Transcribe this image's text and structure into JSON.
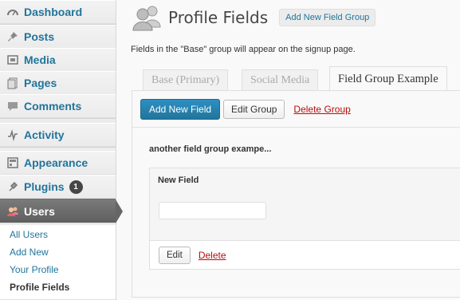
{
  "sidebar": {
    "items": [
      {
        "label": "Dashboard",
        "icon": "dashboard-icon"
      },
      {
        "label": "Posts",
        "icon": "pin-icon"
      },
      {
        "label": "Media",
        "icon": "media-icon"
      },
      {
        "label": "Pages",
        "icon": "pages-icon"
      },
      {
        "label": "Comments",
        "icon": "comments-icon"
      },
      {
        "label": "Activity",
        "icon": "activity-icon"
      },
      {
        "label": "Appearance",
        "icon": "appearance-icon"
      },
      {
        "label": "Plugins",
        "icon": "plugins-icon",
        "badge": "1"
      },
      {
        "label": "Users",
        "icon": "users-icon"
      }
    ],
    "submenu": [
      {
        "label": "All Users"
      },
      {
        "label": "Add New"
      },
      {
        "label": "Your Profile"
      },
      {
        "label": "Profile Fields"
      }
    ]
  },
  "header": {
    "title": "Profile Fields",
    "add_group_label": "Add New Field Group"
  },
  "intro_text": "Fields in the \"Base\" group will appear on the signup page.",
  "tabs": [
    {
      "label": "Base (Primary)"
    },
    {
      "label": "Social Media"
    },
    {
      "label": "Field Group Example"
    }
  ],
  "actions": {
    "add_field": "Add New Field",
    "edit_group": "Edit Group",
    "delete_group": "Delete Group"
  },
  "group_description": "another field group exampe...",
  "field": {
    "title": "New Field",
    "input_value": "",
    "edit_label": "Edit",
    "delete_label": "Delete"
  },
  "colors": {
    "link": "#21759b",
    "delete": "#bc0b0b",
    "primary_button": "#21759b",
    "active_menu": "#6d6d6d"
  }
}
